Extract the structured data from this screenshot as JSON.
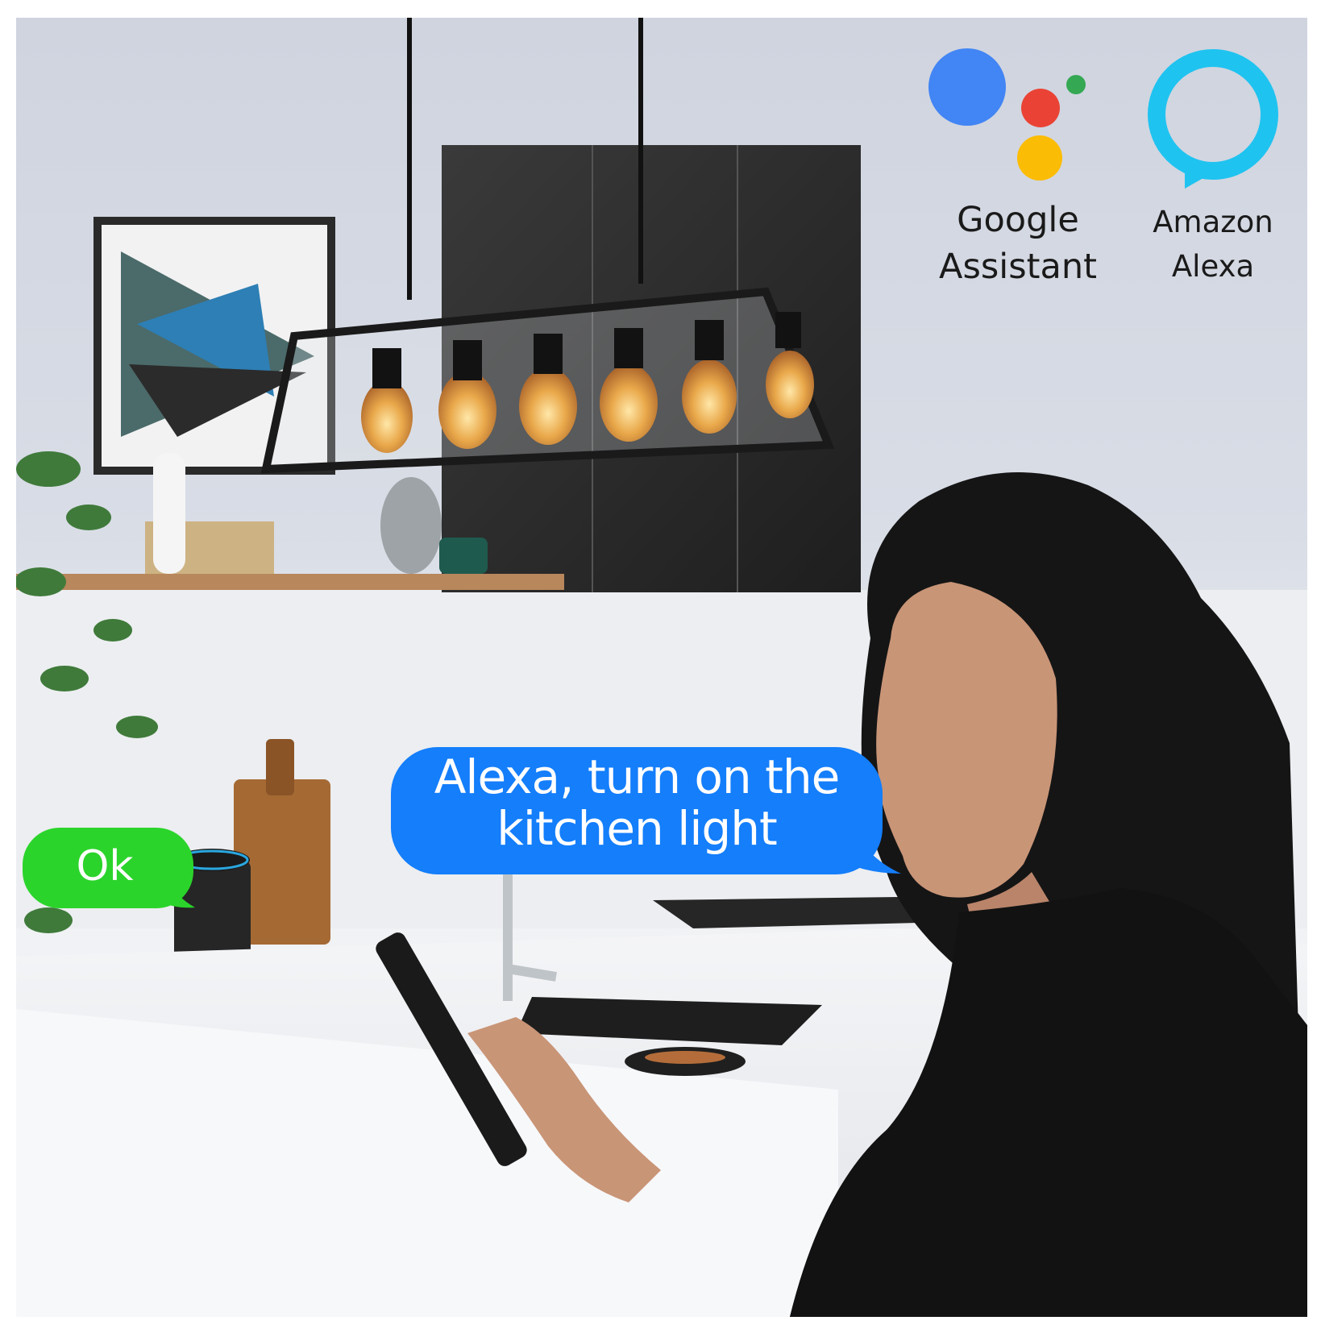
{
  "logos": {
    "google": {
      "label_line1": "Google",
      "label_line2": "Assistant",
      "icon": "google-assistant-icon",
      "colors": [
        "#4285F4",
        "#EA4335",
        "#FBBC05",
        "#34A853"
      ]
    },
    "alexa": {
      "label_line1": "Amazon",
      "label_line2": "Alexa",
      "icon": "amazon-alexa-icon",
      "color": "#1FC3F0"
    }
  },
  "speech": {
    "command_line1": "Alexa, turn on the",
    "command_line2": "kitchen light",
    "command_bubble_color": "#147EFB",
    "reply": "Ok",
    "reply_bubble_color": "#2BD42B"
  }
}
